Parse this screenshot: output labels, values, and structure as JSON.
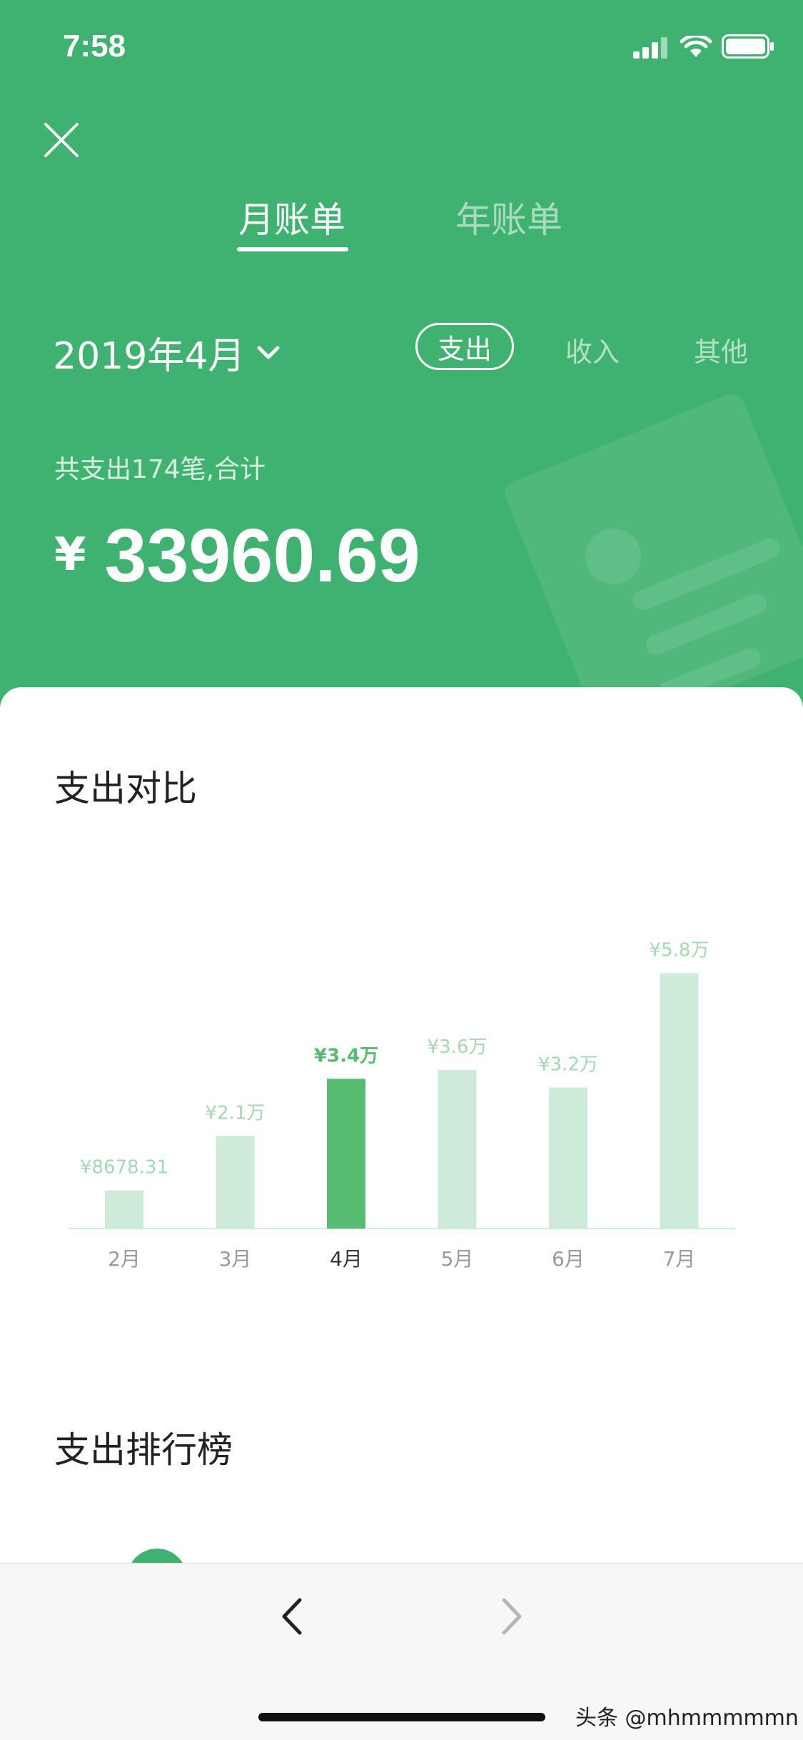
{
  "status_bar": {
    "time": "7:58"
  },
  "tabs": [
    {
      "label": "月账单",
      "active": true
    },
    {
      "label": "年账单",
      "active": false
    }
  ],
  "period": {
    "label": "2019年4月"
  },
  "filters": [
    {
      "label": "支出",
      "active": true
    },
    {
      "label": "收入",
      "active": false
    },
    {
      "label": "其他",
      "active": false
    }
  ],
  "summary": {
    "text": "共支出174笔,合计",
    "currency": "¥",
    "amount": "33960.69"
  },
  "comparison": {
    "title": "支出对比"
  },
  "ranking": {
    "title": "支出排行榜"
  },
  "colors": {
    "brand_green": "#40b26f",
    "bar_active": "#57bb71",
    "bar_inactive": "#cdebd6",
    "label_inactive": "#a3d8b4"
  },
  "chart_data": {
    "type": "bar",
    "categories": [
      "2月",
      "3月",
      "4月",
      "5月",
      "6月",
      "7月"
    ],
    "values": [
      8678.31,
      21000,
      34000,
      36000,
      32000,
      58000
    ],
    "value_labels": [
      "¥8678.31",
      "¥2.1万",
      "¥3.4万",
      "¥3.6万",
      "¥3.2万",
      "¥5.8万"
    ],
    "highlighted": "4月",
    "ylim": [
      0,
      60000
    ],
    "grid": false
  },
  "nav": {
    "back_icon": "chevron-left-icon",
    "forward_icon": "chevron-right-icon"
  },
  "watermark": "头条 @mhmmmmmn"
}
